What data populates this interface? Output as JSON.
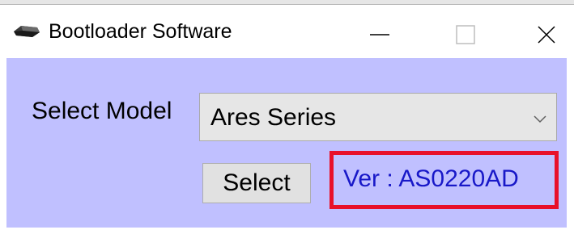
{
  "window": {
    "title": "Bootloader Software",
    "icons": {
      "app": "bootloader-app-icon",
      "minimize": "minimize-icon",
      "maximize": "maximize-icon",
      "close": "close-icon"
    }
  },
  "form": {
    "model_label": "Select Model",
    "model_select": {
      "value": "Ares Series",
      "icon": "chevron-down-icon"
    },
    "select_button_label": "Select",
    "version_text": "Ver : AS0220AD"
  },
  "colors": {
    "client_background": "#c0c0ff",
    "version_text": "#1818c8",
    "highlight_border": "#e8102a"
  }
}
